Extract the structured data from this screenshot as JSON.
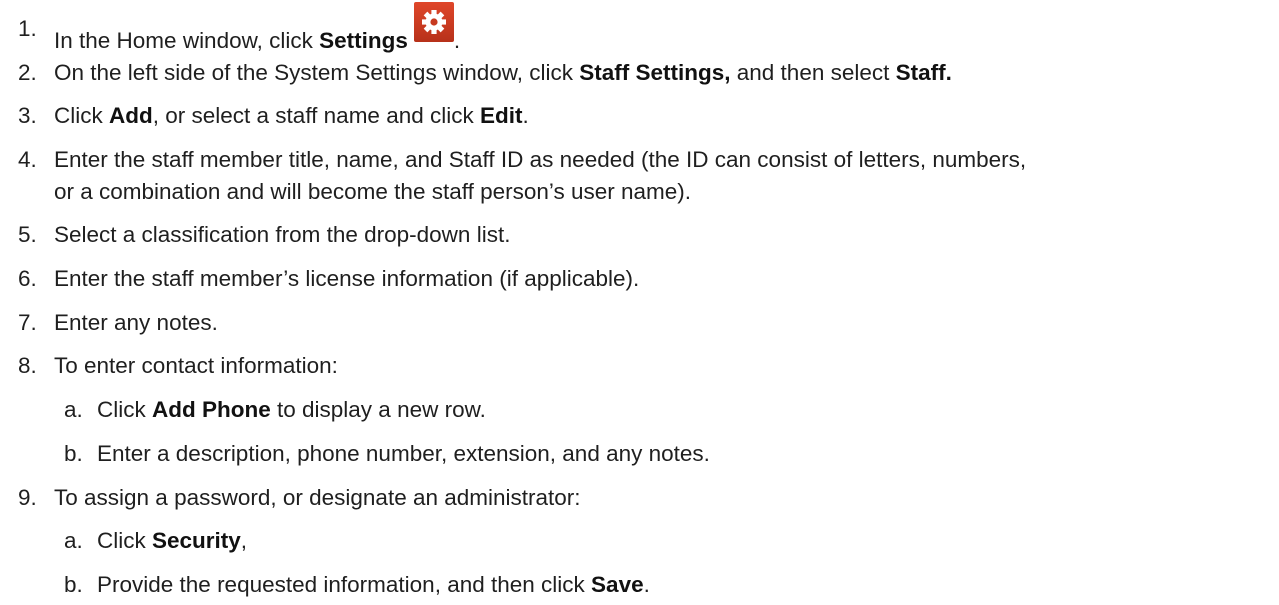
{
  "steps": [
    {
      "num": "1.",
      "pre": "In the Home window, click ",
      "bold": "Settings",
      "post": ".",
      "icon": "gear-icon"
    },
    {
      "num": "2.",
      "pre": "On the left side of the System Settings window, click ",
      "bold": "Staff Settings,",
      "mid": " and then select ",
      "bold2": "Staff."
    },
    {
      "num": "3.",
      "pre": "Click ",
      "bold": "Add",
      "mid": ", or select a staff name and click ",
      "bold2": "Edit",
      "post": "."
    },
    {
      "num": "4.",
      "line1": "Enter the staff member title, name, and Staff ID as needed (the ID can consist of letters, numbers,",
      "line2": "or a combination and will become the staff person’s user name)."
    },
    {
      "num": "5.",
      "text": "Select a classification from the drop-down list."
    },
    {
      "num": "6.",
      "text": "Enter the staff member’s license information (if applicable)."
    },
    {
      "num": "7.",
      "text": "Enter any notes."
    },
    {
      "num": "8.",
      "text": "To enter contact information:",
      "sub": [
        {
          "num": "a.",
          "pre": "Click ",
          "bold": "Add Phone",
          "post": " to display a new row."
        },
        {
          "num": "b.",
          "text": "Enter a description, phone number, extension, and any notes."
        }
      ]
    },
    {
      "num": "9.",
      "text": "To assign a password, or designate an administrator:",
      "sub": [
        {
          "num": "a.",
          "pre": "Click ",
          "bold": "Security",
          "post": ","
        },
        {
          "num": "b.",
          "pre": "Provide the requested information, and then click ",
          "bold": "Save",
          "post": "."
        }
      ]
    }
  ],
  "colors": {
    "icon_bg_top": "#e0472a",
    "icon_bg_bottom": "#b7311a",
    "icon_fg": "#ffffff"
  }
}
